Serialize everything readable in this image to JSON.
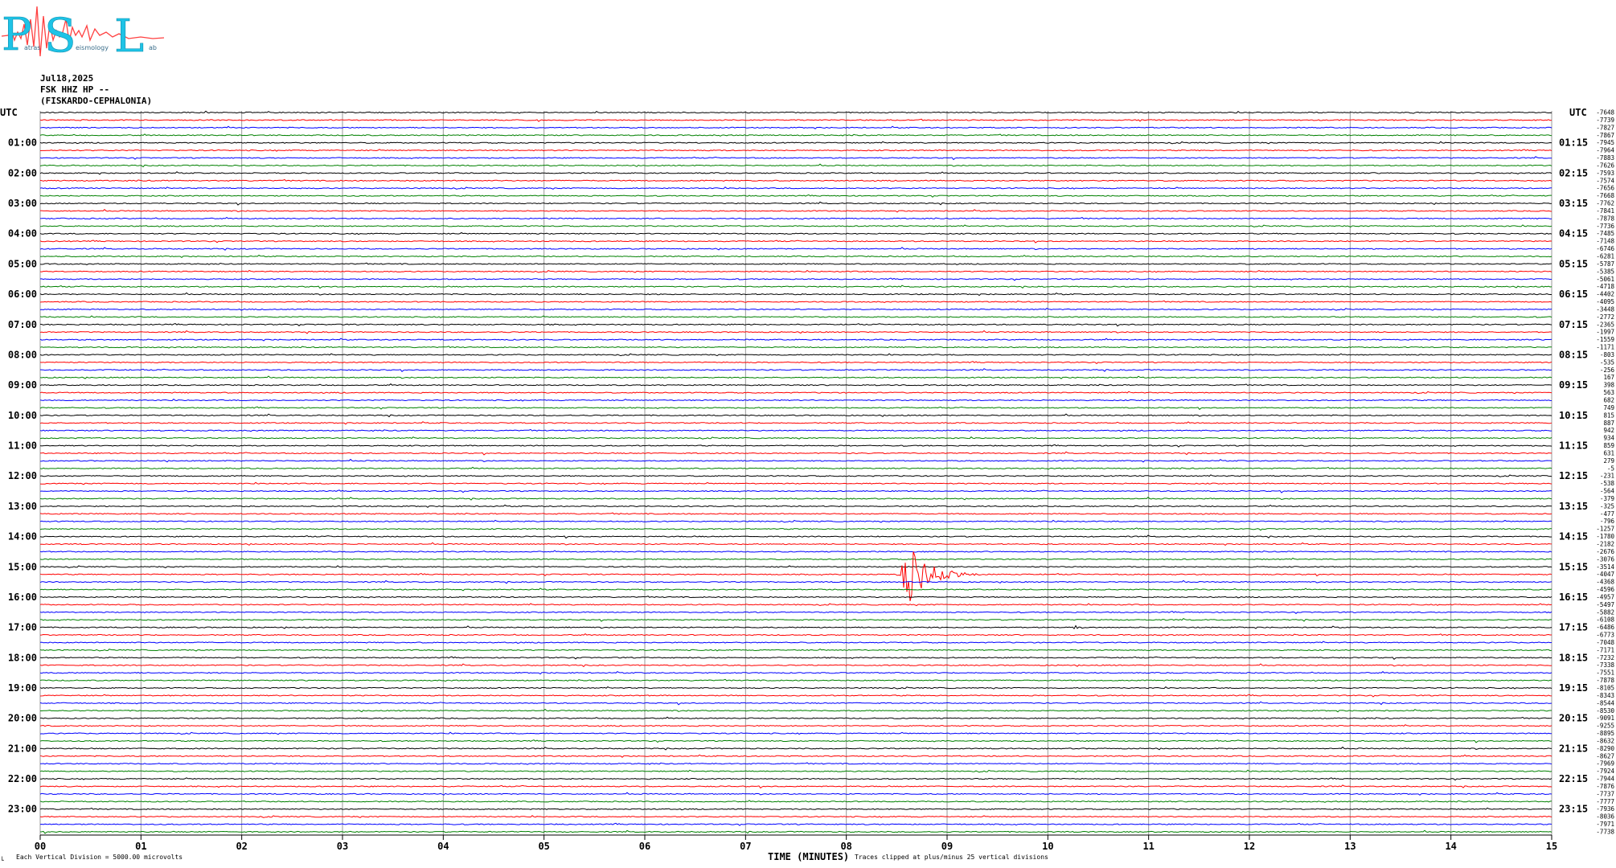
{
  "logo": {
    "letters": [
      "P",
      "S",
      "L"
    ],
    "small_words": [
      "atras",
      "eismology",
      "ab"
    ],
    "colors": {
      "letters": "#1ec3e6",
      "wave": "#ff4040"
    }
  },
  "header": {
    "date": "Jul18,2025",
    "channel": "FSK HHZ HP --",
    "station": "(FISKARDO-CEPHALONIA)"
  },
  "chart_data": {
    "type": "line",
    "title": "",
    "left_axis_header": "UTC",
    "right_axis_header": "UTC",
    "left_hour_labels": [
      "01:00",
      "02:00",
      "03:00",
      "04:00",
      "05:00",
      "06:00",
      "07:00",
      "08:00",
      "09:00",
      "10:00",
      "11:00",
      "12:00",
      "13:00",
      "14:00",
      "15:00",
      "16:00",
      "17:00",
      "18:00",
      "19:00",
      "20:00",
      "21:00",
      "22:00",
      "23:00"
    ],
    "right_hour_labels": [
      "01:15",
      "02:15",
      "03:15",
      "04:15",
      "05:15",
      "06:15",
      "07:15",
      "08:15",
      "09:15",
      "10:15",
      "11:15",
      "12:15",
      "13:15",
      "14:15",
      "15:15",
      "16:15",
      "17:15",
      "18:15",
      "19:15",
      "20:15",
      "21:15",
      "22:15",
      "23:15"
    ],
    "trace_offsets": [
      -7648,
      -7739,
      -7827,
      -7867,
      -7945,
      -7964,
      -7883,
      -7626,
      -7593,
      -7574,
      -7656,
      -7668,
      -7762,
      -7841,
      -7878,
      -7736,
      -7485,
      -7148,
      -6746,
      -6281,
      -5787,
      -5385,
      -5061,
      -4718,
      -4402,
      -4095,
      -3448,
      -2772,
      -2365,
      -1997,
      -1559,
      -1171,
      -803,
      -535,
      -256,
      167,
      398,
      563,
      682,
      749,
      815,
      887,
      942,
      934,
      859,
      631,
      279,
      -5,
      -231,
      -538,
      -564,
      -379,
      -325,
      -477,
      -796,
      -1257,
      -1780,
      -2182,
      -2676,
      -3076,
      -3514,
      -4047,
      -4368,
      -4596,
      -4957,
      -5497,
      -5882,
      -6108,
      -6486,
      -6773,
      -7048,
      -7171,
      -7232,
      -7338,
      -7551,
      -7878,
      -8105,
      -8343,
      -8544,
      -8530,
      -9091,
      -9255,
      -8895,
      -8632,
      -8290,
      -8627,
      -7969,
      -7924,
      -7944,
      -7876,
      -7737,
      -7777,
      -7936,
      -8036,
      -7971,
      -7738
    ],
    "trace_colors": [
      "#000000",
      "#ff0000",
      "#0000ff",
      "#008000"
    ],
    "x_ticks": [
      "00",
      "01",
      "02",
      "03",
      "04",
      "05",
      "06",
      "07",
      "08",
      "09",
      "10",
      "11",
      "12",
      "13",
      "14",
      "15"
    ],
    "xlabel": "TIME (MINUTES)",
    "xlim": [
      0,
      15
    ],
    "grid": true,
    "event": {
      "trace_index": 61,
      "minute_start": 8.5,
      "minute_end": 9.4,
      "peak_divisions": 8
    },
    "minor_event": {
      "trace_index": 68,
      "minute": 10.3
    }
  },
  "footer": {
    "left_mark": "└",
    "scale_note": "Each Vertical Division = 5000.00 microvolts",
    "clip_note": "Traces clipped at plus/minus 25 vertical divisions"
  }
}
